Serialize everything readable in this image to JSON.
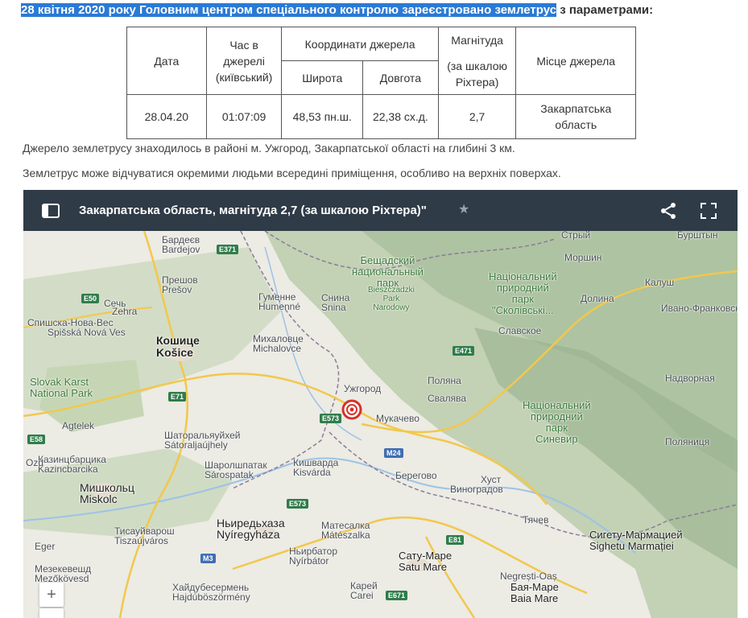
{
  "heading": {
    "highlighted": "28 квітня 2020 року Головним центром спеціального контролю зареєстровано землетрус",
    "rest": " з параметрами:"
  },
  "table": {
    "h_date": "Дата",
    "h_time": "Час в джерелі (київський)",
    "h_coords": "Координати джерела",
    "h_lat": "Широта",
    "h_lon": "Довгота",
    "h_mag_1": "Магнітуда",
    "h_mag_2": "(за шкалою Ріхтера)",
    "h_place": "Місце джерела",
    "date": "28.04.20",
    "time": "01:07:09",
    "lat": "48,53 пн.ш.",
    "lon": "22,38 сх.д.",
    "mag": "2,7",
    "place": "Закарпатська область"
  },
  "para1": "Джерело землетрусу знаходилось в районі м. Ужгород, Закарпатської області на глибині 3 км.",
  "para2": "Землетрус може відчуватися окремими людьми всередині приміщення, особливо на верхніх поверхах.",
  "map": {
    "title": "Закарпатська область, магнітуда 2,7 (за шкалою Ріхтера)\"",
    "star": "★",
    "zoom_in": "+",
    "zoom_out": "−",
    "colors": {
      "header": "#2f3b47",
      "epicenter": "#d0342c",
      "terrain": "#c9d7b8",
      "road": "#f2c84b"
    },
    "places": [
      "Бардеєв",
      "Bardejov",
      "Прешов",
      "Prešov",
      "Гуменне",
      "Humenné",
      "Снина",
      "Snina",
      "Спишска-Нова-Вес",
      "Spišská Nová Ves",
      "Кошице",
      "Košice",
      "Михаловце",
      "Michalovce",
      "Ужгород",
      "Мукачево",
      "Свалява",
      "Поляна",
      "Берегово",
      "Виноградов",
      "Хуст",
      "Тячев",
      "Кишварда",
      "Kisvárda",
      "Шаролшпатак",
      "Sárospatak",
      "Шаторальяуйхей",
      "Sátoraljaújhely",
      "Мишкольц",
      "Miskolc",
      "Ньиредьхаза",
      "Nyíregyháza",
      "Матесалка",
      "Mátészalka",
      "Ньирбатор",
      "Nyírbátor",
      "Сату-Маре",
      "Satu Mare",
      "Карей",
      "Carei",
      "Сигету-Мармацией",
      "Sighetu Marmației",
      "Бая-Маре",
      "Baia Mare",
      "Калуш",
      "Ивано-Франковск",
      "Долина",
      "Славское",
      "Моршин",
      "Стрый",
      "Надворная",
      "Поляниця",
      "Eger",
      "Мезекевешд",
      "Mezőkövesd",
      "Хайдубесермень",
      "Hajdúböszörmény",
      "Тисауйварош",
      "Tiszaújváros",
      "Казинцбарцика",
      "Kazincbarcika",
      "Сечь",
      "Zehra",
      "Agtelek",
      "Ozd",
      "Negrești-Oaș",
      "Бурштын"
    ],
    "parks": [
      "Бещадский\nнациональный\nпарк",
      "Bieszczadzki\nPark\nNarodowy",
      "Національний\nприродний\nпарк\n\"Сколівські...",
      "Національний\nприродний\nпарк\nСиневир",
      "Slovak Karst\nNational Park"
    ],
    "roads": [
      "E371",
      "E50",
      "E71",
      "E573",
      "M24",
      "E471",
      "E81",
      "M3",
      "E671",
      "E58",
      "E573"
    ]
  }
}
